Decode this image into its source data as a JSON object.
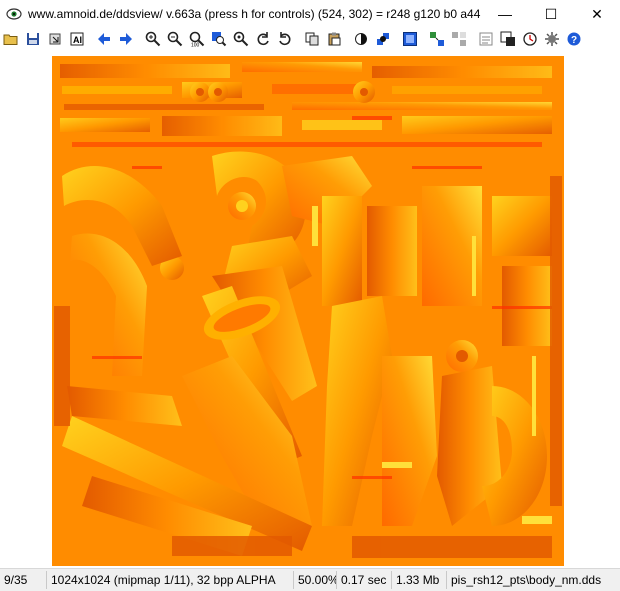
{
  "window": {
    "title": "www.amnoid.de/ddsview/ v.663a (press h for controls) (524, 302) = r248 g120 b0 a44",
    "minimize_glyph": "—",
    "maximize_glyph": "☐",
    "close_glyph": "✕"
  },
  "toolbar": {
    "icons": [
      "open-folder-icon",
      "save-icon",
      "export-icon",
      "text-info-icon",
      "back-arrow-icon",
      "forward-arrow-icon",
      "zoom-in-icon",
      "zoom-out-icon",
      "zoom-100-icon",
      "zoom-fit-icon",
      "zoom-custom-icon",
      "rotate-left-icon",
      "rotate-right-icon",
      "copy-icon",
      "paste-icon",
      "alpha-half-icon",
      "alpha-checker-icon",
      "fullscreen-icon",
      "tile-icon",
      "tile-alt-icon",
      "info-panel-icon",
      "channel-icon",
      "clock-icon",
      "settings-icon",
      "help-icon"
    ],
    "colors": {
      "blue": "#1e5bd8",
      "dark": "#222222",
      "green": "#2f8f3a"
    }
  },
  "texture": {
    "base_color": "#ff8c00",
    "highlight_color": "#ffd21e",
    "shadow_color": "#e35a00",
    "red_accent": "#ff3000"
  },
  "status": {
    "index": "9/35",
    "dimensions": "1024x1024 (mipmap 1/11), 32 bpp ALPHA",
    "zoom": "50.00%",
    "time": "0.17 sec",
    "size": "1.33 Mb",
    "filename": "pis_rsh12_pts\\body_nm.dds"
  }
}
